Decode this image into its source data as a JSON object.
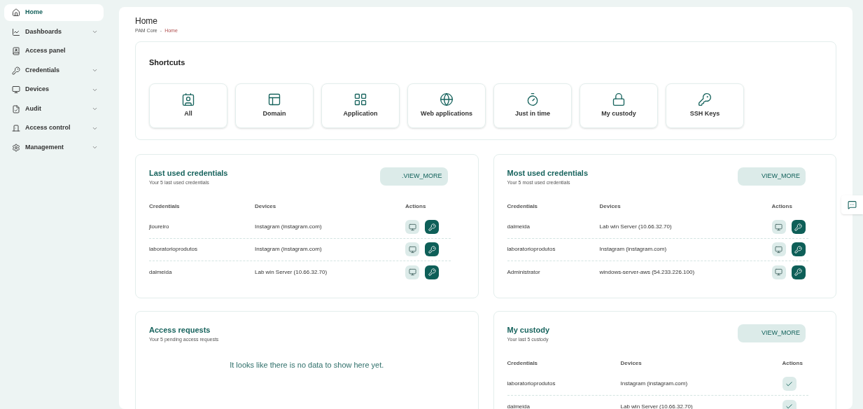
{
  "sidebar": {
    "items": [
      {
        "label": "Home",
        "selected": true,
        "expandable": false
      },
      {
        "label": "Dashboards",
        "selected": false,
        "expandable": true
      },
      {
        "label": "Access panel",
        "selected": false,
        "expandable": false
      },
      {
        "label": "Credentials",
        "selected": false,
        "expandable": true
      },
      {
        "label": "Devices",
        "selected": false,
        "expandable": true
      },
      {
        "label": "Audit",
        "selected": false,
        "expandable": true
      },
      {
        "label": "Access control",
        "selected": false,
        "expandable": true
      },
      {
        "label": "Management",
        "selected": false,
        "expandable": true
      }
    ]
  },
  "page": {
    "title": "Home",
    "breadcrumb": {
      "items": [
        "PAM Core",
        "Home"
      ],
      "separator": "-"
    }
  },
  "shortcuts": {
    "title": "Shortcuts",
    "items": [
      {
        "label": "All"
      },
      {
        "label": "Domain"
      },
      {
        "label": "Application"
      },
      {
        "label": "Web applications"
      },
      {
        "label": "Just in time"
      },
      {
        "label": "My custody"
      },
      {
        "label": "SSH Keys"
      }
    ]
  },
  "panels": [
    {
      "kind": "table",
      "title": "Last used credentials",
      "subtitle": "Your 5 last used credentials",
      "button": ".VIEW_MORE",
      "columns": [
        "Credentials",
        "Devices",
        "Actions"
      ],
      "rows": [
        {
          "credential": "jloureiro",
          "device": "Instagram (instagram.com)",
          "actions": [
            {
              "kind": "monitor"
            },
            {
              "kind": "key"
            }
          ]
        },
        {
          "credential": "laboratorioprodutos",
          "device": "Instagram (instagram.com)",
          "actions": [
            {
              "kind": "monitor"
            },
            {
              "kind": "key"
            }
          ]
        },
        {
          "credential": "dalmeida",
          "device": "Lab win Server (10.66.32.70)",
          "actions": [
            {
              "kind": "monitor"
            },
            {
              "kind": "key"
            }
          ]
        }
      ]
    },
    {
      "kind": "table",
      "title": "Most used credentials",
      "subtitle": "Your 5 most used credentials",
      "button": "VIEW_MORE",
      "columns": [
        "Credentials",
        "Devices",
        "Actions"
      ],
      "rows": [
        {
          "credential": "dalmeida",
          "device": "Lab win Server (10.66.32.70)",
          "actions": [
            {
              "kind": "monitor"
            },
            {
              "kind": "key"
            }
          ]
        },
        {
          "credential": "laboratorioprodutos",
          "device": "Instagram (instagram.com)",
          "actions": [
            {
              "kind": "monitor"
            },
            {
              "kind": "key"
            }
          ]
        },
        {
          "credential": "Administrator",
          "device": "windows-server-aws (54.233.226.100)",
          "actions": [
            {
              "kind": "monitor"
            },
            {
              "kind": "key"
            }
          ]
        }
      ]
    },
    {
      "kind": "empty",
      "title": "Access requests",
      "subtitle": "Your 5 pending access requests",
      "message": "It looks like there is no data to show here yet."
    },
    {
      "kind": "table",
      "title": "My custody",
      "subtitle": "Your last 5 custody",
      "button": "VIEW_MORE",
      "columns": [
        "Credentials",
        "Devices",
        "Actions"
      ],
      "rows": [
        {
          "credential": "laboratorioprodutos",
          "device": "Instagram (instagram.com)",
          "actions": [
            {
              "kind": "check"
            }
          ]
        },
        {
          "credential": "dalmeida",
          "device": "Lab win Server (10.66.32.70)",
          "actions": [
            {
              "kind": "check"
            }
          ]
        }
      ]
    }
  ]
}
